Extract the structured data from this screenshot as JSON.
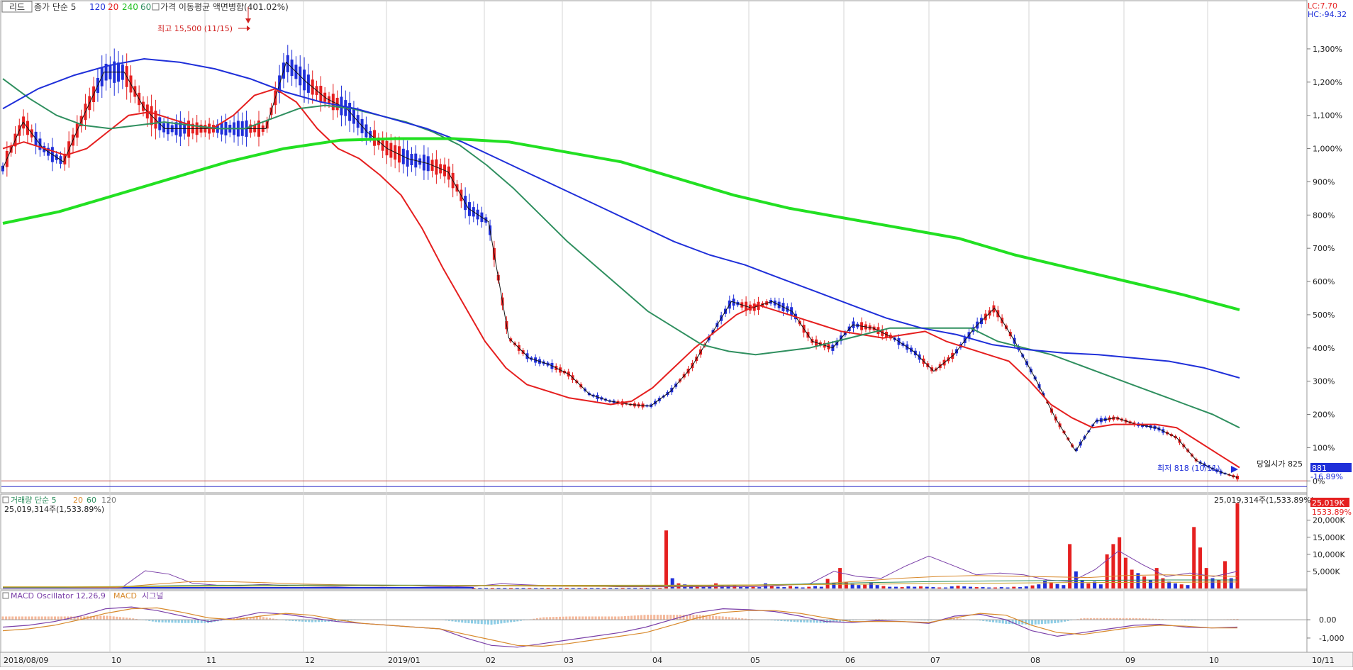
{
  "colors": {
    "red": "#e51f1f",
    "blue": "#1f2fd9",
    "green_bright": "#22e022",
    "green_dark": "#2f8f5f",
    "black": "#111111",
    "purple": "#7a3fa8",
    "orange": "#d8892b",
    "macd_pos": "#f4b89a",
    "macd_neg": "#8ccde6",
    "gold": "#c9a227"
  },
  "price_panel": {
    "tab_label": "리드",
    "ma_title": "종가 단순 5",
    "ma_periods": [
      "120",
      "20",
      "240",
      "60"
    ],
    "overlay_label": "가격 이동평균 액면병합(401.02%)",
    "lc_label": "LC:7.70",
    "hc_label": "HC:-94.32",
    "high_note": "최고 15,500 (11/15)",
    "low_note": "최저 818 (10/11)",
    "today_open_label": "당일시가 825",
    "current_tag": "881",
    "current_pct": "-16.89%",
    "zero_label": "0%"
  },
  "volume_panel": {
    "title": "거래량 단순 5",
    "ma_periods": [
      "20",
      "60",
      "120"
    ],
    "left_value": "25,019,314주(1,533.89%)",
    "right_value": "25,019,314주(1,533.89%)",
    "current_tag": "25,019K",
    "current_pct": "1533.89%"
  },
  "macd_panel": {
    "title": "MACD Oscillator 12,26,9",
    "line_labels": [
      "MACD",
      "시그널"
    ]
  },
  "x_axis": {
    "labels": [
      "2018/08/09",
      "10",
      "11",
      "12",
      "2019/01",
      "02",
      "03",
      "04",
      "05",
      "06",
      "07",
      "08",
      "09",
      "10",
      "10/11"
    ]
  },
  "chart_data": [
    {
      "type": "line",
      "title": "가격 이동평균",
      "y_axis_labels": [
        "1,300%",
        "1,200%",
        "1,100%",
        "1,000%",
        "900%",
        "800%",
        "700%",
        "600%",
        "500%",
        "400%",
        "300%",
        "200%",
        "100%",
        "0%",
        "-16.89%"
      ],
      "ylim": [
        -25,
        1430
      ],
      "x": [
        0,
        7,
        14,
        21,
        28,
        35,
        42,
        49,
        56,
        63,
        70,
        77,
        84,
        91,
        98,
        105,
        112,
        119,
        126,
        133,
        140,
        147,
        154,
        161,
        168,
        175,
        182,
        189,
        196,
        203,
        210,
        217,
        224,
        231,
        238,
        245,
        252,
        259,
        266,
        273,
        280,
        287,
        294,
        301,
        308,
        315,
        322,
        329,
        336,
        343,
        350,
        357,
        364,
        371,
        378,
        385,
        392,
        399,
        406,
        413,
        420,
        427
      ],
      "series": [
        {
          "name": "5",
          "color": "black",
          "values": [
            940,
            1080,
            1000,
            960,
            1100,
            1230,
            1230,
            1120,
            1060,
            1060,
            1060,
            1060,
            1060,
            1060,
            1260,
            1200,
            1150,
            1120,
            1050,
            1000,
            970,
            955,
            930,
            820,
            780,
            430,
            370,
            350,
            320,
            260,
            240,
            230,
            225,
            270,
            340,
            440,
            540,
            520,
            540,
            510,
            420,
            400,
            470,
            460,
            430,
            390,
            330,
            380,
            460,
            520,
            420,
            310,
            190,
            90,
            180,
            190,
            170,
            160,
            130,
            60,
            30,
            10
          ]
        },
        {
          "name": "20",
          "color": "red",
          "values": [
            1000,
            1020,
            1000,
            980,
            1000,
            1050,
            1100,
            1110,
            1090,
            1070,
            1060,
            1100,
            1160,
            1180,
            1140,
            1060,
            1000,
            970,
            920,
            860,
            760,
            640,
            530,
            420,
            340,
            290,
            270,
            250,
            240,
            230,
            240,
            280,
            340,
            400,
            450,
            500,
            530,
            510,
            490,
            470,
            450,
            440,
            430,
            440,
            450,
            420,
            400,
            380,
            360,
            300,
            230,
            190,
            160,
            170,
            170,
            170,
            160,
            120,
            80,
            40
          ]
        },
        {
          "name": "60",
          "color": "green_dark",
          "values": [
            1210,
            1150,
            1100,
            1070,
            1060,
            1070,
            1080,
            1070,
            1060,
            1060,
            1090,
            1120,
            1130,
            1120,
            1100,
            1080,
            1050,
            1010,
            950,
            880,
            800,
            720,
            650,
            580,
            510,
            460,
            410,
            390,
            380,
            390,
            400,
            420,
            440,
            460,
            460,
            460,
            460,
            420,
            400,
            380,
            350,
            320,
            290,
            260,
            230,
            200,
            160
          ]
        },
        {
          "name": "120",
          "color": "blue",
          "values": [
            1120,
            1180,
            1220,
            1250,
            1270,
            1260,
            1240,
            1210,
            1170,
            1140,
            1120,
            1090,
            1060,
            1020,
            970,
            920,
            870,
            820,
            770,
            720,
            680,
            650,
            610,
            570,
            530,
            490,
            460,
            440,
            410,
            395,
            385,
            380,
            370,
            360,
            340,
            310
          ]
        },
        {
          "name": "240",
          "color": "green_bright",
          "values": [
            775,
            810,
            860,
            910,
            960,
            1000,
            1025,
            1030,
            1030,
            1020,
            990,
            960,
            910,
            860,
            820,
            790,
            760,
            730,
            680,
            640,
            600,
            560,
            515
          ]
        }
      ]
    },
    {
      "type": "bar",
      "title": "거래량",
      "y_axis_labels": [
        "20,000K",
        "15,000K",
        "10,000K",
        "5,000K"
      ],
      "ylim": [
        0,
        27000
      ],
      "values": [
        100,
        100,
        100,
        100,
        100,
        100,
        100,
        100,
        100,
        100,
        100,
        100,
        100,
        100,
        100,
        100,
        100,
        100,
        100,
        100,
        100,
        100,
        100,
        100,
        100,
        100,
        100,
        100,
        100,
        100,
        100,
        17000,
        3000,
        1500,
        1200,
        1000,
        800,
        600,
        800,
        1500,
        900,
        700,
        800,
        600,
        500,
        600,
        400,
        1500,
        800,
        500,
        400,
        700,
        500,
        300,
        500,
        700,
        500,
        2800,
        1500,
        6000,
        1800,
        1400,
        1000,
        1100,
        1800,
        1000,
        700,
        500,
        500,
        400,
        600,
        500,
        600,
        500,
        400,
        300,
        300,
        600,
        800,
        600,
        500,
        400,
        400,
        300,
        300,
        400,
        300,
        500,
        400,
        600,
        900,
        1200,
        2200,
        1800,
        1300,
        1000,
        13000,
        5000,
        2500,
        1500,
        2000,
        1200,
        10000,
        13000,
        15000,
        9000,
        5500,
        4500,
        3500,
        2500,
        6000,
        3000,
        2000,
        1500,
        1200,
        1000,
        18000,
        12000,
        6000,
        3000,
        2500,
        8000,
        3000,
        25019
      ],
      "ma_series": [
        {
          "name": "5",
          "color": "purple",
          "values": [
            200,
            200,
            200,
            200,
            200,
            200,
            5200,
            4200,
            1500,
            1000,
            900,
            1200,
            800,
            700,
            600,
            800,
            700,
            900,
            600,
            500,
            700,
            1400,
            1100,
            800,
            800,
            700,
            500,
            500,
            500,
            500,
            500,
            500,
            600,
            1000,
            1400,
            5000,
            3500,
            3000,
            6500,
            9500,
            6800,
            4000,
            4500,
            4000,
            2500,
            2000,
            5500,
            11000,
            7000,
            3500,
            4500,
            3500,
            5000
          ]
        },
        {
          "name": "20",
          "color": "orange",
          "values": [
            300,
            300,
            300,
            300,
            1200,
            2000,
            2000,
            1700,
            1300,
            1100,
            1000,
            900,
            800,
            750,
            700,
            650,
            600,
            600,
            650,
            700,
            900,
            1100,
            1500,
            2200,
            3000,
            3500,
            3800,
            3600,
            3400,
            3200,
            3800,
            4000,
            3800,
            3500
          ]
        },
        {
          "name": "60",
          "color": "green_dark",
          "values": [
            400,
            400,
            600,
            900,
            1000,
            1000,
            1000,
            950,
            900,
            850,
            800,
            850,
            1000,
            1300,
            1700,
            2000,
            2200,
            2300,
            2400,
            2500,
            2500
          ]
        },
        {
          "name": "120",
          "color": "gold",
          "values": [
            500,
            500,
            600,
            700,
            800,
            850,
            900,
            950,
            1000,
            1100,
            1300,
            1500,
            1700,
            1800,
            1900
          ]
        }
      ]
    },
    {
      "type": "line",
      "title": "MACD Oscillator 12,26,9",
      "y_axis_labels": [
        "0.00",
        "-1,000"
      ],
      "ylim": [
        -1700,
        1400
      ],
      "series": [
        {
          "name": "MACD",
          "color": "purple",
          "values": [
            -400,
            -300,
            -100,
            200,
            600,
            700,
            500,
            200,
            -100,
            100,
            400,
            300,
            100,
            -100,
            -200,
            -300,
            -400,
            -500,
            -1000,
            -1400,
            -1500,
            -1300,
            -1100,
            -900,
            -700,
            -400,
            0,
            400,
            600,
            550,
            450,
            200,
            -100,
            -150,
            -50,
            -100,
            -200,
            200,
            300,
            0,
            -600,
            -900,
            -700,
            -500,
            -300,
            -250,
            -400,
            -450,
            -400
          ]
        },
        {
          "name": "시그널",
          "color": "orange",
          "values": [
            -600,
            -500,
            -300,
            0,
            350,
            600,
            650,
            400,
            100,
            0,
            200,
            350,
            250,
            0,
            -200,
            -300,
            -400,
            -500,
            -800,
            -1100,
            -1400,
            -1450,
            -1300,
            -1100,
            -900,
            -700,
            -300,
            100,
            400,
            500,
            500,
            350,
            100,
            -100,
            -100,
            -100,
            -150,
            100,
            350,
            250,
            -300,
            -700,
            -800,
            -600,
            -400,
            -300,
            -350,
            -450,
            -450
          ]
        }
      ]
    }
  ]
}
